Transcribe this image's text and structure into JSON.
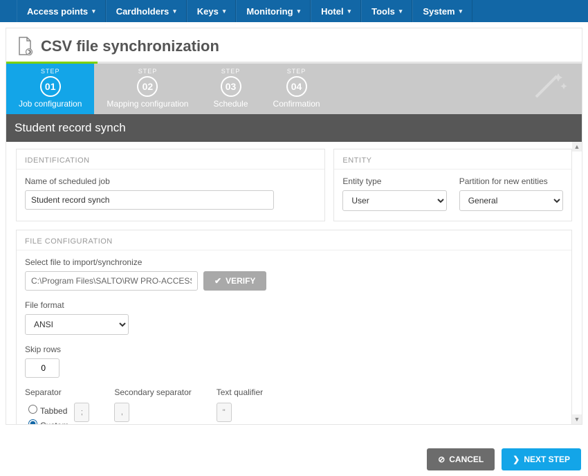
{
  "nav": {
    "items": [
      "Access points",
      "Cardholders",
      "Keys",
      "Monitoring",
      "Hotel",
      "Tools",
      "System"
    ]
  },
  "page": {
    "title": "CSV file synchronization",
    "subtitle": "Student record synch"
  },
  "wizard": {
    "step_label": "STEP",
    "steps": [
      {
        "num": "01",
        "name": "Job configuration"
      },
      {
        "num": "02",
        "name": "Mapping configuration"
      },
      {
        "num": "03",
        "name": "Schedule"
      },
      {
        "num": "04",
        "name": "Confirmation"
      }
    ],
    "active": 0
  },
  "identification": {
    "header": "IDENTIFICATION",
    "name_label": "Name of scheduled job",
    "name_value": "Student record synch"
  },
  "entity": {
    "header": "ENTITY",
    "type_label": "Entity type",
    "type_value": "User",
    "partition_label": "Partition for new entities",
    "partition_value": "General"
  },
  "fileconfig": {
    "header": "FILE CONFIGURATION",
    "select_label": "Select file to import/synchronize",
    "path": "C:\\Program Files\\SALTO\\RW PRO-ACCESS\\Users.t",
    "verify": "VERIFY",
    "format_label": "File format",
    "format_value": "ANSI",
    "skip_label": "Skip rows",
    "skip_value": "0",
    "separator_label": "Separator",
    "separator_tabbed": "Tabbed",
    "separator_custom": "Custom",
    "separator_custom_value": ";",
    "secondary_label": "Secondary separator",
    "secondary_value": ",",
    "qualifier_label": "Text qualifier",
    "qualifier_value": "\""
  },
  "footer": {
    "cancel": "CANCEL",
    "next": "NEXT STEP"
  }
}
